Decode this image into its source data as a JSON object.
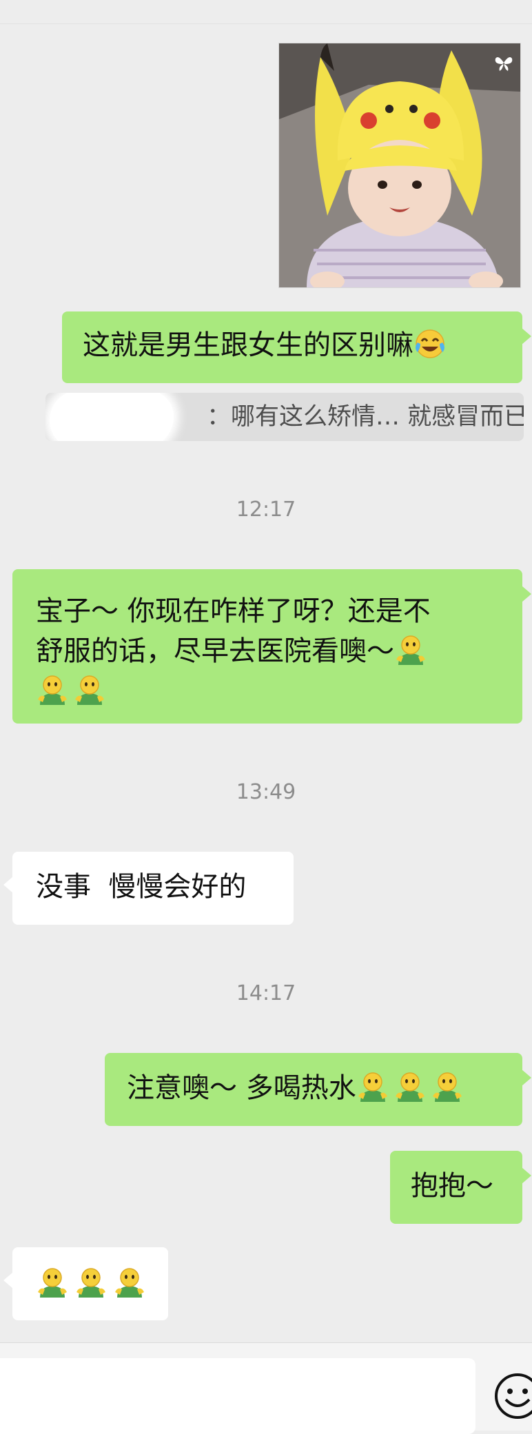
{
  "messages": {
    "image_message": {
      "alt": "baby in yellow Pikachu-ear hat"
    },
    "m1": {
      "text": "这就是男生跟女生的区别嘛"
    },
    "quote": {
      "text": "：哪有这么矫情… 就感冒而已"
    },
    "t1": {
      "time": "12:17"
    },
    "m2": {
      "line1": "宝子～ 你现在咋样了呀？还是不",
      "line2": "舒服的话，尽早去医院看噢～"
    },
    "t2": {
      "time": "13:49"
    },
    "m3": {
      "text": "没事  慢慢会好的"
    },
    "t3": {
      "time": "14:17"
    },
    "m4": {
      "text": "注意噢～ 多喝热水"
    },
    "m5": {
      "text": "抱抱～"
    }
  },
  "icons": {
    "emoji_laugh_cry": "face-with-tears-of-joy",
    "emoji_person": "person-in-green-shirt",
    "live_badge": "butterfly-icon",
    "emoji_button": "smiley-icon"
  },
  "colors": {
    "background": "#EDEDED",
    "outgoing_bubble": "#A9E97E",
    "incoming_bubble": "#FFFFFF",
    "timestamp": "#8C8C8C"
  }
}
